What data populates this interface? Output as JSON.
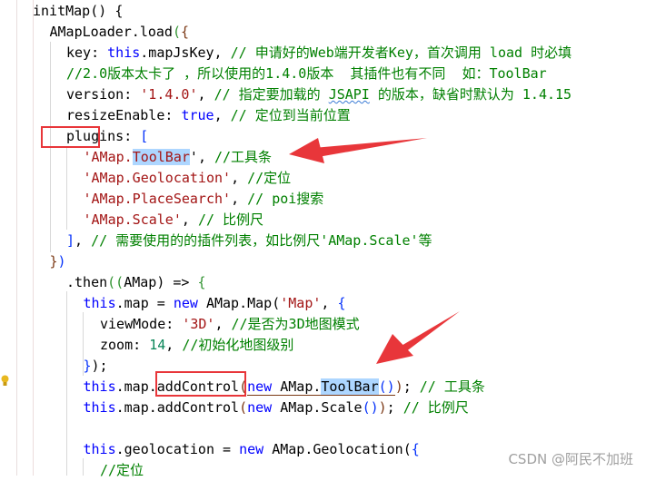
{
  "editor": {
    "lines": [
      {
        "indent": 0,
        "tokens": [
          [
            "initMap() ",
            ""
          ],
          [
            "{",
            ""
          ]
        ]
      },
      {
        "indent": 1,
        "tokens": [
          [
            "AMapLoader.load",
            ""
          ],
          [
            "(",
            "br2"
          ],
          [
            "{",
            "br3"
          ]
        ]
      },
      {
        "indent": 2,
        "tokens": [
          [
            "key: ",
            ""
          ],
          [
            "this",
            "kw"
          ],
          [
            ".mapJsKey, ",
            ""
          ],
          [
            "// 申请好的Web端开发者Key，首次调用 load 时必填",
            "cm"
          ]
        ]
      },
      {
        "indent": 2,
        "tokens": [
          [
            "//2.0版本太卡了 ，所以使用的1.4.0版本  其插件也有不同  如：ToolBar",
            "cm"
          ]
        ]
      },
      {
        "indent": 2,
        "tokens": [
          [
            "version: ",
            ""
          ],
          [
            "'1.4.0'",
            "str"
          ],
          [
            ", ",
            ""
          ],
          [
            "// 指定要加载的 ",
            "cm"
          ],
          [
            "JSAPI",
            "cm squig"
          ],
          [
            " 的版本，缺省时默认为 1.4.15",
            "cm"
          ]
        ]
      },
      {
        "indent": 2,
        "tokens": [
          [
            "resizeEnable: ",
            ""
          ],
          [
            "true",
            "kw"
          ],
          [
            ", ",
            ""
          ],
          [
            "// 定位到当前位置",
            "cm"
          ]
        ]
      },
      {
        "indent": 2,
        "tokens": [
          [
            "plugins: ",
            ""
          ],
          [
            "[",
            "br1"
          ]
        ]
      },
      {
        "indent": 3,
        "tokens": [
          [
            "'AMap.",
            "str"
          ],
          [
            "ToolBar",
            "str hl"
          ],
          [
            "'",
            ""
          ],
          [
            ", ",
            ""
          ],
          [
            "//工具条",
            "cm"
          ]
        ]
      },
      {
        "indent": 3,
        "tokens": [
          [
            "'AMap.Geolocation'",
            "str"
          ],
          [
            ", ",
            ""
          ],
          [
            "//定位",
            "cm"
          ]
        ]
      },
      {
        "indent": 3,
        "tokens": [
          [
            "'AMap.PlaceSearch'",
            "str"
          ],
          [
            ", ",
            ""
          ],
          [
            "// poi搜索",
            "cm"
          ]
        ]
      },
      {
        "indent": 3,
        "tokens": [
          [
            "'AMap.Scale'",
            "str"
          ],
          [
            ", ",
            ""
          ],
          [
            "// 比例尺",
            "cm"
          ]
        ]
      },
      {
        "indent": 2,
        "tokens": [
          [
            "]",
            "br1"
          ],
          [
            ", ",
            ""
          ],
          [
            "// 需要使用的的插件列表，如比例尺'AMap.Scale'等",
            "cm"
          ]
        ]
      },
      {
        "indent": 1,
        "tokens": [
          [
            "}",
            "br3"
          ],
          [
            ")",
            "br1"
          ]
        ]
      },
      {
        "indent": 2,
        "tokens": [
          [
            ".then",
            ""
          ],
          [
            "((",
            "br2"
          ],
          [
            "AMap",
            ""
          ],
          [
            ") ",
            ""
          ],
          [
            "=> ",
            ""
          ],
          [
            "{",
            "br2"
          ]
        ]
      },
      {
        "indent": 3,
        "tokens": [
          [
            "this",
            "kw"
          ],
          [
            ".map = ",
            ""
          ],
          [
            "new ",
            "kw"
          ],
          [
            "AMap.Map",
            ""
          ],
          [
            "(",
            ""
          ],
          [
            "'Map'",
            "str"
          ],
          [
            ", ",
            ""
          ],
          [
            "{",
            "br1"
          ]
        ]
      },
      {
        "indent": 4,
        "tokens": [
          [
            "viewMode: ",
            ""
          ],
          [
            "'3D'",
            "str"
          ],
          [
            ", ",
            ""
          ],
          [
            "//是否为3D地图模式",
            "cm"
          ]
        ]
      },
      {
        "indent": 4,
        "tokens": [
          [
            "zoom: ",
            ""
          ],
          [
            "14",
            "num"
          ],
          [
            ", ",
            ""
          ],
          [
            "//初始化地图级别",
            "cm"
          ]
        ]
      },
      {
        "indent": 3,
        "tokens": [
          [
            "}",
            "br1"
          ],
          [
            ");",
            ""
          ]
        ]
      },
      {
        "indent": 3,
        "tokens": [
          [
            "this",
            "kw"
          ],
          [
            ".map.",
            ""
          ],
          [
            "addControl",
            ""
          ],
          [
            "(",
            "br3"
          ],
          [
            "new ",
            "kw uline"
          ],
          [
            "AMap.",
            "uline"
          ],
          [
            "ToolBar",
            "hl uline"
          ],
          [
            "()",
            "br1 uline"
          ],
          [
            ")",
            "br3"
          ],
          [
            "; ",
            ""
          ],
          [
            "// 工具条",
            "cm"
          ]
        ]
      },
      {
        "indent": 3,
        "tokens": [
          [
            "this",
            "kw"
          ],
          [
            ".map.addControl",
            ""
          ],
          [
            "(",
            "br3"
          ],
          [
            "new ",
            "kw"
          ],
          [
            "AMap.Scale",
            ""
          ],
          [
            "()",
            "br1"
          ],
          [
            ")",
            "br3"
          ],
          [
            "; ",
            ""
          ],
          [
            "// 比例尺",
            "cm"
          ]
        ]
      },
      {
        "indent": 3,
        "tokens": []
      },
      {
        "indent": 3,
        "tokens": [
          [
            "this",
            "kw"
          ],
          [
            ".geolocation = ",
            ""
          ],
          [
            "new ",
            "kw"
          ],
          [
            "AMap.Geolocation",
            ""
          ],
          [
            "(",
            ""
          ],
          [
            "{",
            "br1"
          ]
        ]
      },
      {
        "indent": 4,
        "tokens": [
          [
            "//定位",
            "cm"
          ]
        ]
      }
    ]
  },
  "colors": {
    "annotation_red": "#e8363a",
    "highlight": "#add6ff",
    "keyword": "#0000ff",
    "string": "#a31515",
    "comment": "#008000"
  },
  "annotations": {
    "boxes": [
      "plugins",
      "addControl"
    ],
    "arrows": [
      "arrow-to-ToolBar-plugin",
      "arrow-to-addControl"
    ]
  },
  "watermark": "CSDN @阿民不加班"
}
